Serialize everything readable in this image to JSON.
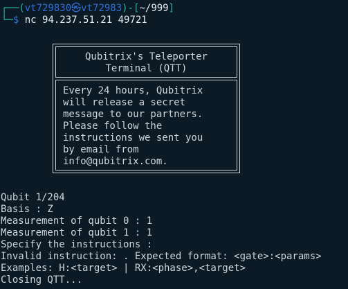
{
  "prompt": {
    "corner_top": "┌──(",
    "user": "vt729830",
    "skull": "㉿",
    "host": "vt72983",
    "bracket_mid": ")-[",
    "path": "~/999",
    "bracket_end": "]",
    "corner_bottom": "└─",
    "dollar": "$",
    "command": "nc 94.237.51.21 49721"
  },
  "banner": {
    "title_lines": [
      "Qubitrix's Teleporter",
      "Terminal (QTT)"
    ],
    "body_lines": [
      "Every 24 hours, Qubitrix",
      "will release a secret",
      "message to our partners.",
      "Please follow the",
      "instructions we sent you",
      "by email from",
      "info@qubitrix.com."
    ]
  },
  "output": [
    "Qubit 1/204",
    "Basis : Z",
    "Measurement of qubit 0 : 1",
    "Measurement of qubit 1 : 1",
    "Specify the instructions :",
    "Invalid instruction: . Expected format: <gate>:<params>",
    "Examples: H:<target> | RX:<phase>,<target>",
    "Closing QTT..."
  ],
  "colors": {
    "background": "#0c1a26",
    "text": "#cfd6dc",
    "prompt_teal": "#2bb6a7",
    "prompt_blue": "#2f6fd6"
  }
}
